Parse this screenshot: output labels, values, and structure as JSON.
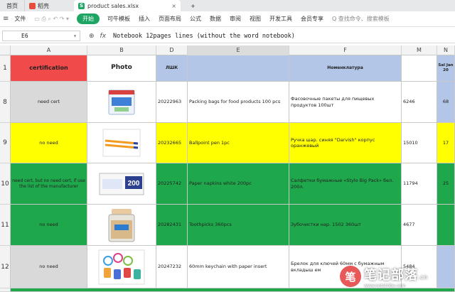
{
  "tabs": {
    "home": "首页",
    "doc": "稻壳",
    "active": "product sales.xlsx",
    "close_glyph": "×",
    "add_glyph": "+"
  },
  "menu": {
    "file": "文件",
    "start": "开始",
    "items": [
      "可牛模板",
      "插入",
      "页面布局",
      "公式",
      "数据",
      "审阅",
      "视图",
      "开发工具",
      "会员专享"
    ],
    "search": "Q 查找命令、搜索模板"
  },
  "formula_bar": {
    "cell_ref": "E6",
    "zoom_icon": "zoom-icon",
    "fx": "fx",
    "content": "Notebook 12pages lines  (without the word notebook)"
  },
  "columns": [
    "A",
    "B",
    "D",
    "E",
    "F",
    "M",
    "N"
  ],
  "header_row": {
    "row": "1",
    "certification": "certification",
    "photo": "Photo",
    "code": "ЛШК",
    "nomenclature": "Номенклатура",
    "sales_partial": "Sal Jan 20"
  },
  "rows": [
    {
      "row": "8",
      "cert": "need cert",
      "code": "20222963",
      "name": "Packing bags for food products 100 pcs",
      "ru": "Фасовочные пакеты для пищевых продуктов 100шт",
      "m": "6246",
      "n": "68",
      "photo": "bags-photo"
    },
    {
      "row": "9",
      "cert": "no need",
      "code": "20232665",
      "name": "Ballpoint pen 1pc",
      "ru": "Ручка шар. синяя \"Darvish\" корпус оранжевый",
      "m": "15010",
      "n": "17",
      "photo": "pen-photo"
    },
    {
      "row": "10",
      "cert": "need cert, but no need cert, if use the list of the manufacturer",
      "code": "20225742",
      "name": "Paper napkins white 200pc",
      "ru": "Салфетки бумажные «Stylo Big Pack» бел. 200л.",
      "m": "11794",
      "n": "25",
      "photo": "napkins-photo",
      "napkin_label": "200"
    },
    {
      "row": "11",
      "cert": "no need",
      "code": "20282431",
      "name": "Toothpicks  360pcs",
      "ru": "Зубочистки нар. 1502 360шт",
      "m": "4677",
      "n": "",
      "photo": "toothpicks-photo"
    },
    {
      "row": "12",
      "cert": "no need",
      "code": "20247232",
      "name": "60mm keychain with paper insert",
      "ru": "Брелок для ключей 60мм с бумажным вкладыш ем",
      "m": "5484",
      "n": "",
      "photo": "keychain-photo"
    }
  ],
  "colors": {
    "cert_header": "#f04a4a",
    "header_blue": "#b4c6e7",
    "grey": "#d9d9d9",
    "yellow": "#ffff00",
    "green": "#1fa74b",
    "brand_green": "#1ea563"
  },
  "watermark": {
    "logo_glyph": "笔",
    "title": "笔记部落",
    "suffix": ".cn",
    "url": "www.notetribe.com"
  }
}
